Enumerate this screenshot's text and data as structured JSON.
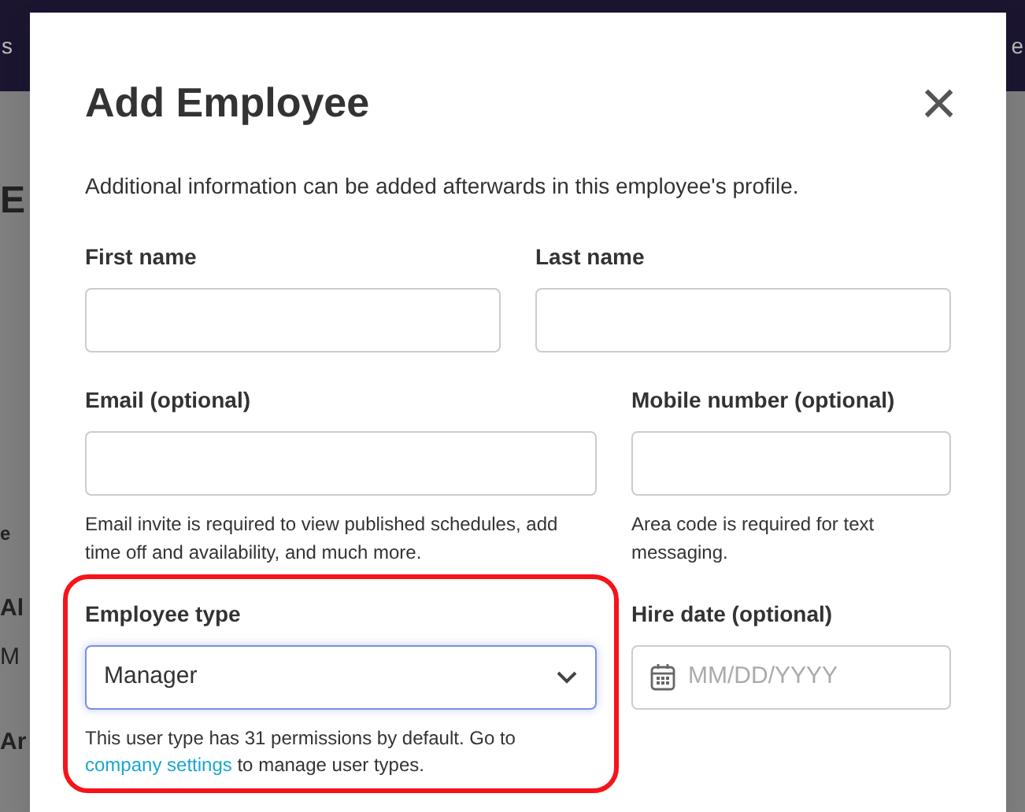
{
  "background": {
    "nav_left": "s",
    "nav_right": "e",
    "left_fragments": [
      "E",
      "e",
      "Al",
      "M",
      "Ar"
    ]
  },
  "modal": {
    "title": "Add Employee",
    "close": "×",
    "intro": "Additional information can be added afterwards in this employee's profile.",
    "rows": [
      {
        "fields": [
          {
            "kind": "text",
            "label": "First name",
            "focused": false,
            "highlighted": false
          },
          {
            "kind": "text",
            "label": "Last name",
            "focused": false,
            "highlighted": false
          }
        ]
      },
      {
        "fields": [
          {
            "kind": "text",
            "label": "Email (optional)",
            "focused": false,
            "highlighted": false,
            "help": [
              {
                "kind": "text",
                "text": "Email invite is required to view published schedules, add time off and availability, and much more."
              }
            ]
          },
          {
            "kind": "text",
            "label": "Mobile number (optional)",
            "focused": false,
            "highlighted": false,
            "help": [
              {
                "kind": "text",
                "text": "Area code is required for text messaging."
              }
            ]
          }
        ]
      },
      {
        "fields": [
          {
            "kind": "select",
            "label": "Employee type",
            "value": "Manager",
            "focused": true,
            "highlighted": true,
            "help": [
              {
                "kind": "text",
                "text": "This user type has 31 permissions by default. Go to "
              },
              {
                "kind": "link",
                "text": "company settings"
              },
              {
                "kind": "text",
                "text": " to manage user types."
              }
            ]
          },
          {
            "kind": "date",
            "label": "Hire date (optional)",
            "placeholder": "MM/DD/YYYY",
            "focused": false,
            "highlighted": false
          }
        ]
      }
    ]
  }
}
